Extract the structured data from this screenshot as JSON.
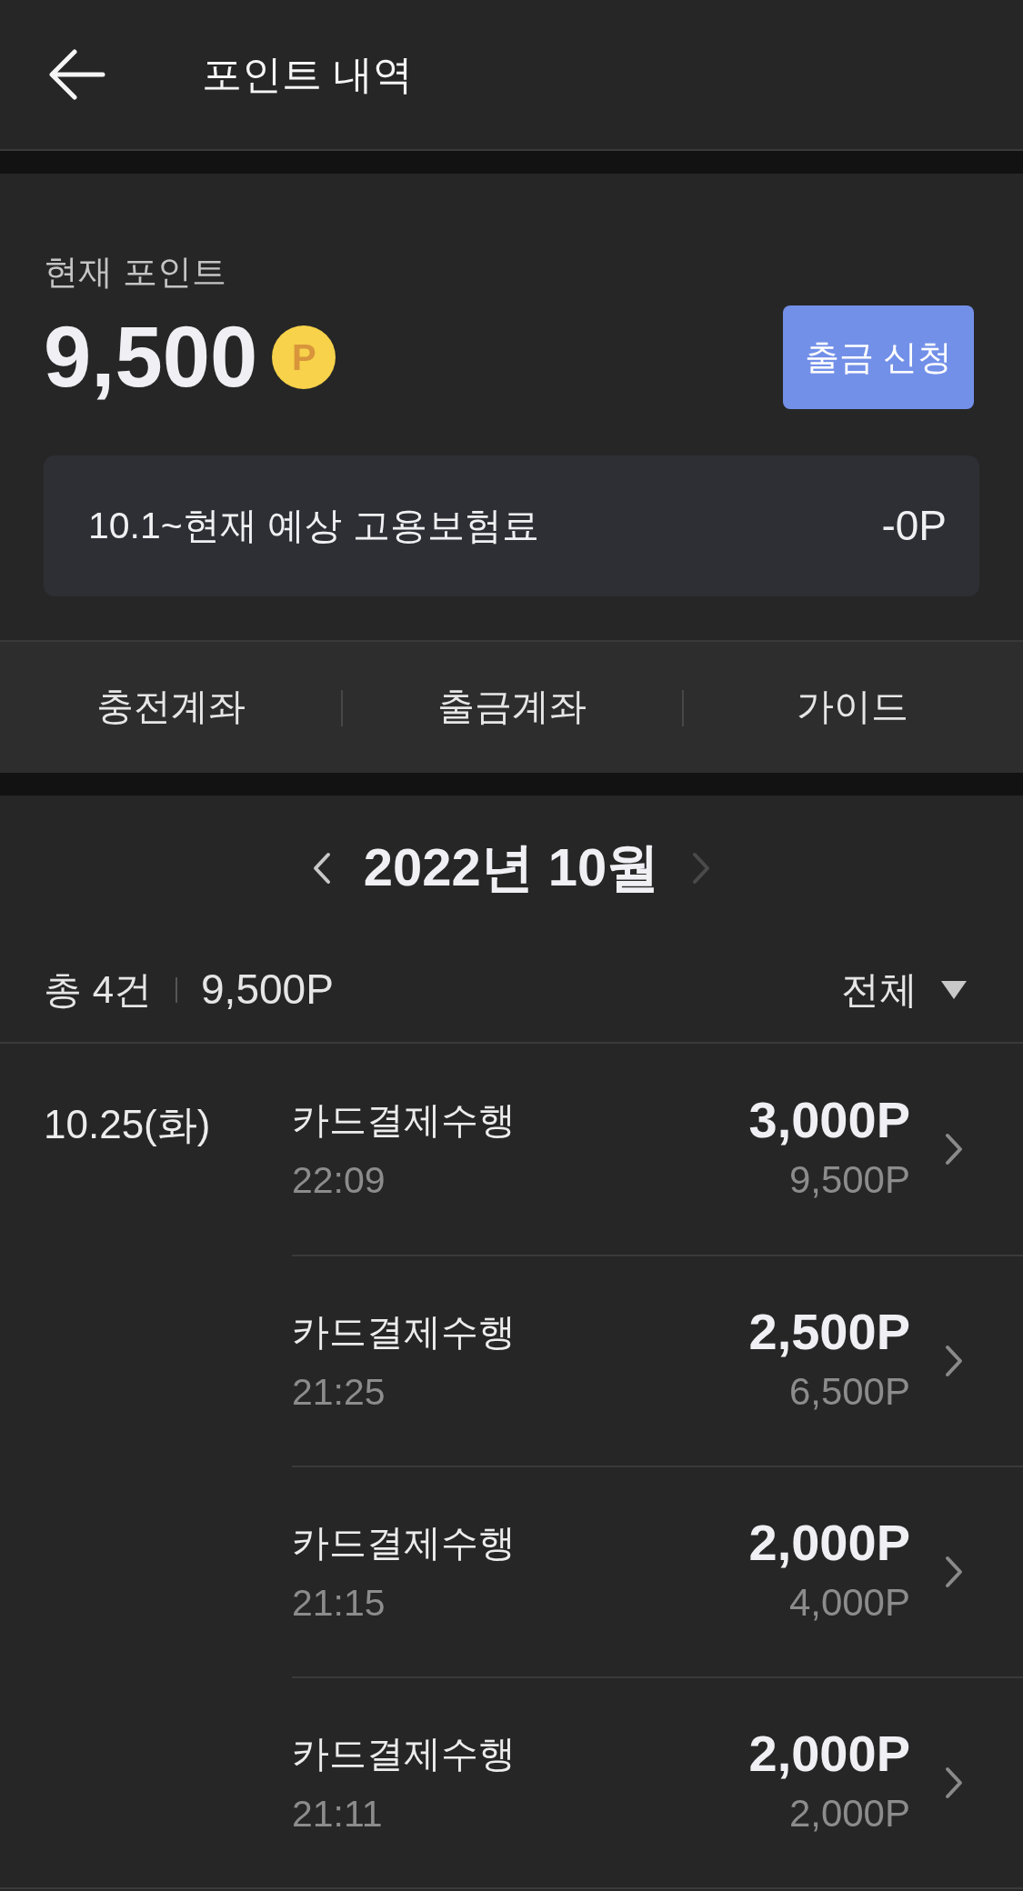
{
  "header": {
    "title": "포인트 내역"
  },
  "balance": {
    "label": "현재 포인트",
    "amount": "9,500",
    "coin": "P",
    "withdraw_button": "출금 신청"
  },
  "insurance": {
    "label": "10.1~현재 예상 고용보험료",
    "value": "-0P"
  },
  "links": [
    {
      "label": "충전계좌"
    },
    {
      "label": "출금계좌"
    },
    {
      "label": "가이드"
    }
  ],
  "month_nav": {
    "title": "2022년 10월",
    "prev": {
      "disabled": false
    },
    "next": {
      "disabled": true
    }
  },
  "summary": {
    "count": "총 4건",
    "total": "9,500P",
    "filter": "전체"
  },
  "days": [
    {
      "date": "10.25(화)",
      "transactions": [
        {
          "title": "카드결제수행",
          "time": "22:09",
          "amount": "3,000P",
          "balance": "9,500P"
        },
        {
          "title": "카드결제수행",
          "time": "21:25",
          "amount": "2,500P",
          "balance": "6,500P"
        },
        {
          "title": "카드결제수행",
          "time": "21:15",
          "amount": "2,000P",
          "balance": "4,000P"
        },
        {
          "title": "카드결제수행",
          "time": "21:11",
          "amount": "2,000P",
          "balance": "2,000P"
        }
      ]
    }
  ]
}
